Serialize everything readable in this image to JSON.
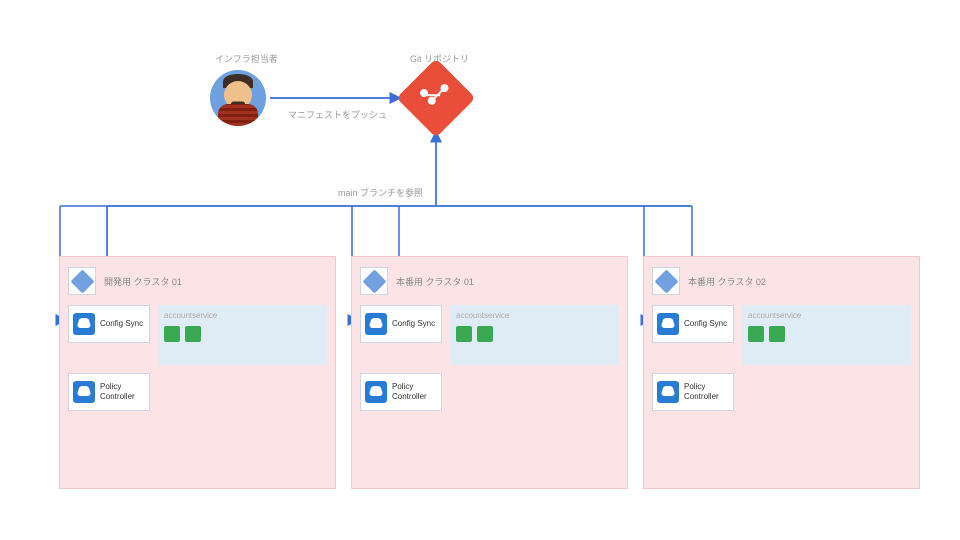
{
  "actor_label": "インフラ担当者",
  "git_label": "Git リポジトリ",
  "push_label": "マニフェストをプッシュ",
  "ref_label": "main ブランチを参照",
  "clusters": [
    {
      "title": "開発用 クラスタ 01"
    },
    {
      "title": "本番用 クラスタ 01"
    },
    {
      "title": "本番用 クラスタ 02"
    }
  ],
  "config_sync": "Config Sync",
  "policy_controller": "Policy Controller",
  "service_name": "accountservice"
}
